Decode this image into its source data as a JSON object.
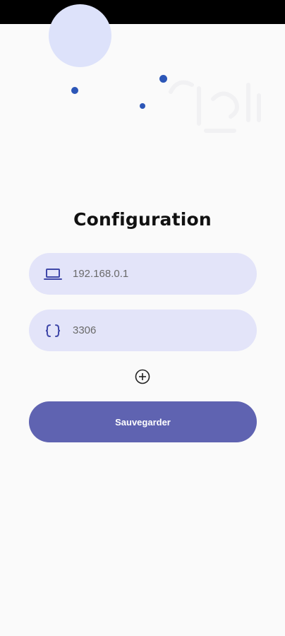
{
  "page": {
    "title": "Configuration"
  },
  "form": {
    "host": {
      "value": "192.168.0.1",
      "icon": "laptop-icon"
    },
    "port": {
      "value": "3306",
      "icon": "curly-braces-icon"
    },
    "add_icon": "add-circle-icon",
    "save_label": "Sauvegarder"
  },
  "colors": {
    "accent": "#5f63b1",
    "field_background": "#e3e4f9",
    "decoration_dots": "#2c56b7",
    "decoration_circle": "#dde2fa"
  }
}
